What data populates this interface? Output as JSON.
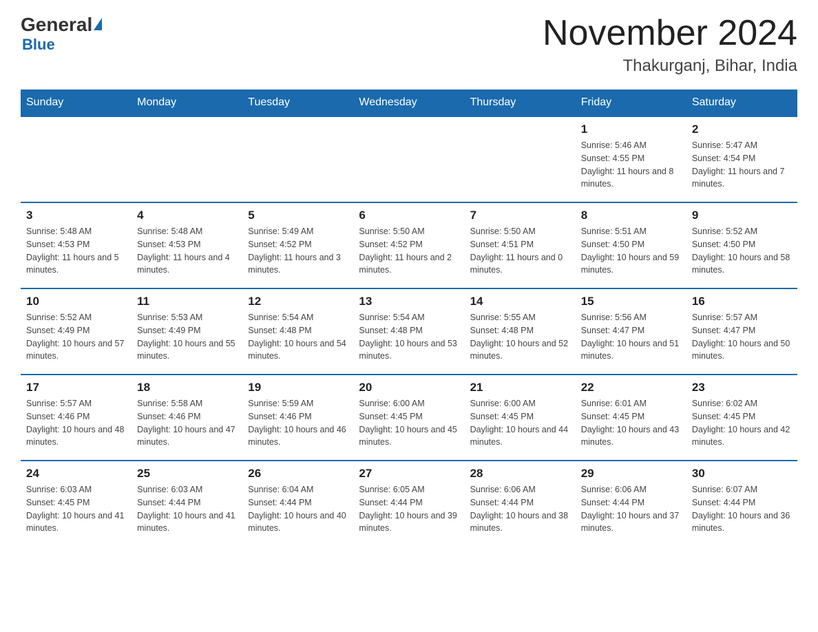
{
  "logo": {
    "general": "General",
    "blue": "Blue"
  },
  "calendar": {
    "title": "November 2024",
    "subtitle": "Thakurganj, Bihar, India",
    "days_of_week": [
      "Sunday",
      "Monday",
      "Tuesday",
      "Wednesday",
      "Thursday",
      "Friday",
      "Saturday"
    ],
    "weeks": [
      [
        {
          "day": "",
          "info": ""
        },
        {
          "day": "",
          "info": ""
        },
        {
          "day": "",
          "info": ""
        },
        {
          "day": "",
          "info": ""
        },
        {
          "day": "",
          "info": ""
        },
        {
          "day": "1",
          "info": "Sunrise: 5:46 AM\nSunset: 4:55 PM\nDaylight: 11 hours and 8 minutes."
        },
        {
          "day": "2",
          "info": "Sunrise: 5:47 AM\nSunset: 4:54 PM\nDaylight: 11 hours and 7 minutes."
        }
      ],
      [
        {
          "day": "3",
          "info": "Sunrise: 5:48 AM\nSunset: 4:53 PM\nDaylight: 11 hours and 5 minutes."
        },
        {
          "day": "4",
          "info": "Sunrise: 5:48 AM\nSunset: 4:53 PM\nDaylight: 11 hours and 4 minutes."
        },
        {
          "day": "5",
          "info": "Sunrise: 5:49 AM\nSunset: 4:52 PM\nDaylight: 11 hours and 3 minutes."
        },
        {
          "day": "6",
          "info": "Sunrise: 5:50 AM\nSunset: 4:52 PM\nDaylight: 11 hours and 2 minutes."
        },
        {
          "day": "7",
          "info": "Sunrise: 5:50 AM\nSunset: 4:51 PM\nDaylight: 11 hours and 0 minutes."
        },
        {
          "day": "8",
          "info": "Sunrise: 5:51 AM\nSunset: 4:50 PM\nDaylight: 10 hours and 59 minutes."
        },
        {
          "day": "9",
          "info": "Sunrise: 5:52 AM\nSunset: 4:50 PM\nDaylight: 10 hours and 58 minutes."
        }
      ],
      [
        {
          "day": "10",
          "info": "Sunrise: 5:52 AM\nSunset: 4:49 PM\nDaylight: 10 hours and 57 minutes."
        },
        {
          "day": "11",
          "info": "Sunrise: 5:53 AM\nSunset: 4:49 PM\nDaylight: 10 hours and 55 minutes."
        },
        {
          "day": "12",
          "info": "Sunrise: 5:54 AM\nSunset: 4:48 PM\nDaylight: 10 hours and 54 minutes."
        },
        {
          "day": "13",
          "info": "Sunrise: 5:54 AM\nSunset: 4:48 PM\nDaylight: 10 hours and 53 minutes."
        },
        {
          "day": "14",
          "info": "Sunrise: 5:55 AM\nSunset: 4:48 PM\nDaylight: 10 hours and 52 minutes."
        },
        {
          "day": "15",
          "info": "Sunrise: 5:56 AM\nSunset: 4:47 PM\nDaylight: 10 hours and 51 minutes."
        },
        {
          "day": "16",
          "info": "Sunrise: 5:57 AM\nSunset: 4:47 PM\nDaylight: 10 hours and 50 minutes."
        }
      ],
      [
        {
          "day": "17",
          "info": "Sunrise: 5:57 AM\nSunset: 4:46 PM\nDaylight: 10 hours and 48 minutes."
        },
        {
          "day": "18",
          "info": "Sunrise: 5:58 AM\nSunset: 4:46 PM\nDaylight: 10 hours and 47 minutes."
        },
        {
          "day": "19",
          "info": "Sunrise: 5:59 AM\nSunset: 4:46 PM\nDaylight: 10 hours and 46 minutes."
        },
        {
          "day": "20",
          "info": "Sunrise: 6:00 AM\nSunset: 4:45 PM\nDaylight: 10 hours and 45 minutes."
        },
        {
          "day": "21",
          "info": "Sunrise: 6:00 AM\nSunset: 4:45 PM\nDaylight: 10 hours and 44 minutes."
        },
        {
          "day": "22",
          "info": "Sunrise: 6:01 AM\nSunset: 4:45 PM\nDaylight: 10 hours and 43 minutes."
        },
        {
          "day": "23",
          "info": "Sunrise: 6:02 AM\nSunset: 4:45 PM\nDaylight: 10 hours and 42 minutes."
        }
      ],
      [
        {
          "day": "24",
          "info": "Sunrise: 6:03 AM\nSunset: 4:45 PM\nDaylight: 10 hours and 41 minutes."
        },
        {
          "day": "25",
          "info": "Sunrise: 6:03 AM\nSunset: 4:44 PM\nDaylight: 10 hours and 41 minutes."
        },
        {
          "day": "26",
          "info": "Sunrise: 6:04 AM\nSunset: 4:44 PM\nDaylight: 10 hours and 40 minutes."
        },
        {
          "day": "27",
          "info": "Sunrise: 6:05 AM\nSunset: 4:44 PM\nDaylight: 10 hours and 39 minutes."
        },
        {
          "day": "28",
          "info": "Sunrise: 6:06 AM\nSunset: 4:44 PM\nDaylight: 10 hours and 38 minutes."
        },
        {
          "day": "29",
          "info": "Sunrise: 6:06 AM\nSunset: 4:44 PM\nDaylight: 10 hours and 37 minutes."
        },
        {
          "day": "30",
          "info": "Sunrise: 6:07 AM\nSunset: 4:44 PM\nDaylight: 10 hours and 36 minutes."
        }
      ]
    ]
  }
}
